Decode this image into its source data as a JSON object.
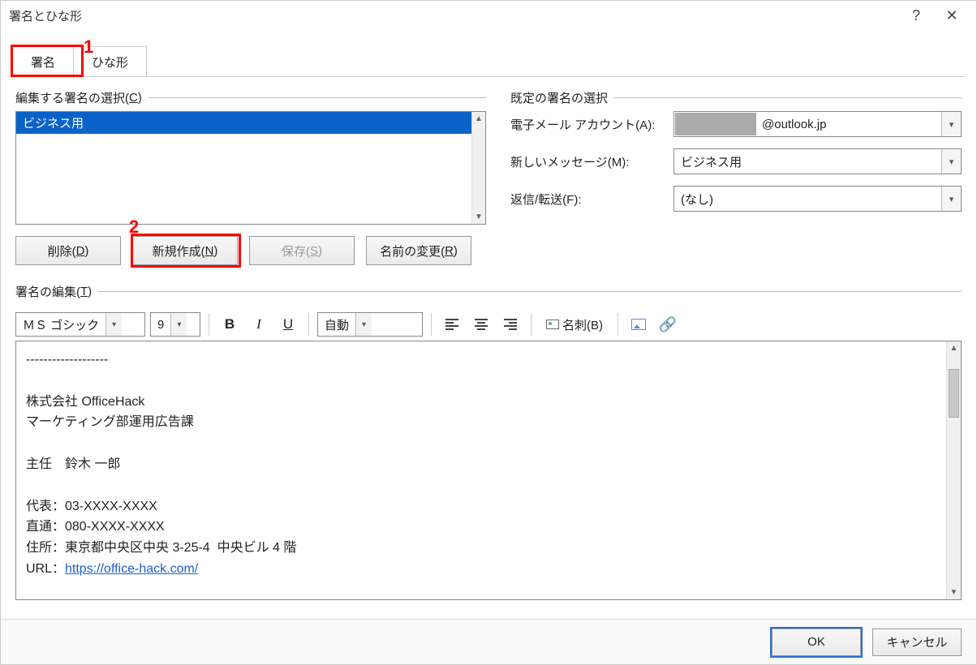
{
  "window": {
    "title": "署名とひな形"
  },
  "tabs": {
    "t1": "署名",
    "t2": "ひな形"
  },
  "callouts": {
    "c1": "1",
    "c2": "2"
  },
  "left": {
    "group_label_a": "編集する署名の選択(",
    "group_label_b": "C",
    "group_label_c": ")",
    "items": [
      "ビジネス用"
    ],
    "btn_delete_a": "削除(",
    "btn_delete_b": "D",
    "btn_delete_c": ")",
    "btn_new_a": "新規作成(",
    "btn_new_b": "N",
    "btn_new_c": ")",
    "btn_save_a": "保存(",
    "btn_save_b": "S",
    "btn_save_c": ")",
    "btn_rename_a": "名前の変更(",
    "btn_rename_b": "R",
    "btn_rename_c": ")"
  },
  "right": {
    "group_label": "既定の署名の選択",
    "f1_label_a": "電子メール アカウント(",
    "f1_label_b": "A",
    "f1_label_c": "):",
    "f1_value": "@outlook.jp",
    "f2_label_a": "新しいメッセージ(",
    "f2_label_b": "M",
    "f2_label_c": "):",
    "f2_value": "ビジネス用",
    "f3_label_a": "返信/転送(",
    "f3_label_b": "F",
    "f3_label_c": "):",
    "f3_value": "(なし)"
  },
  "editsec": {
    "label_a": "署名の編集(",
    "label_b": "T",
    "label_c": ")",
    "font": "ＭＳ ゴシック",
    "size": "9",
    "color": "自動",
    "vcard_a": "名刺(",
    "vcard_b": "B",
    "vcard_c": ")",
    "line1": "-------------------",
    "line2": "",
    "line3": "株式会社 OfficeHack",
    "line4": "マーケティング部運用広告課",
    "line5": "",
    "line6": "主任　鈴木 一郎",
    "line7": "",
    "line8": "代表：03-XXXX-XXXX",
    "line9": "直通：080-XXXX-XXXX",
    "line10": "住所：東京都中央区中央 3-25-4  中央ビル 4 階",
    "url_prefix": "URL：",
    "url": "https://office-hack.com/",
    "line12": "",
    "line13": "-------------------"
  },
  "footer": {
    "ok": "OK",
    "cancel": "キャンセル"
  }
}
